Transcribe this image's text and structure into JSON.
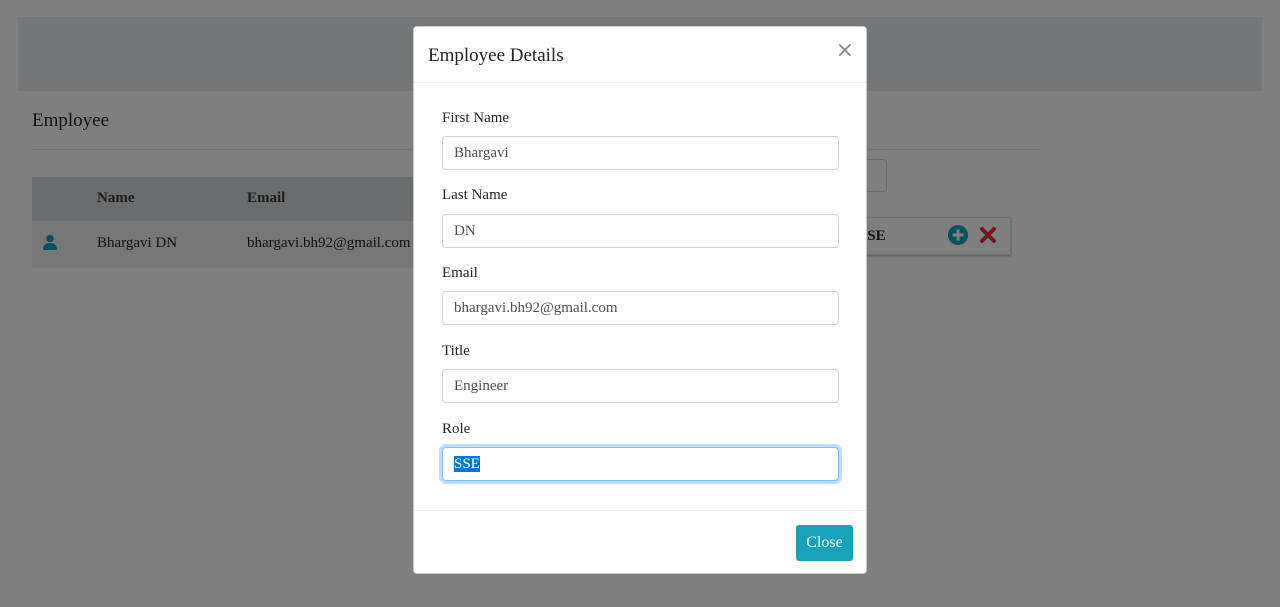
{
  "page": {
    "heading": "Employee",
    "table": {
      "columns": [
        "Name",
        "Email"
      ],
      "rows": [
        {
          "name": "Bhargavi DN",
          "email": "bhargavi.bh92@gmail.com"
        }
      ]
    },
    "role_card": {
      "text": "i SSE"
    }
  },
  "modal": {
    "title": "Employee Details",
    "close_x": "×",
    "fields": [
      {
        "label": "First Name",
        "value": "Bhargavi"
      },
      {
        "label": "Last Name",
        "value": "DN"
      },
      {
        "label": "Email",
        "value": "bhargavi.bh92@gmail.com"
      },
      {
        "label": "Title",
        "value": "Engineer"
      },
      {
        "label": "Role",
        "value": "SSE"
      }
    ],
    "close_button": "Close"
  },
  "colors": {
    "accent": "#17a2b8",
    "delete": "#dc3545",
    "user_icon": "#17a2b8",
    "selection": "#0078d7"
  },
  "icons": {
    "user": "user-icon",
    "add": "plus-circle-icon",
    "delete": "times-icon",
    "close": "close-icon"
  }
}
